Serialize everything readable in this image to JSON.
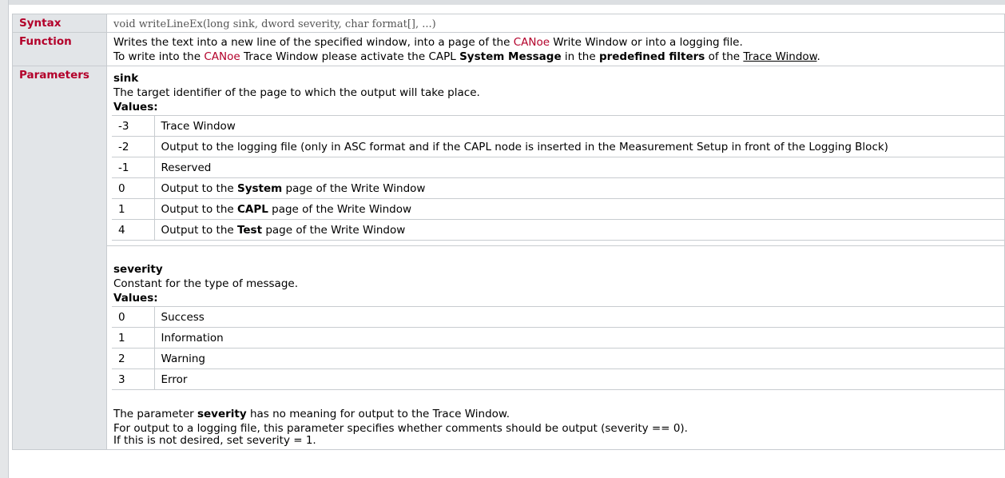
{
  "rows": {
    "syntax": {
      "label": "Syntax",
      "code": "void writeLineEx(long sink, dword severity, char format[], ...)"
    },
    "function": {
      "label": "Function",
      "line1": {
        "a": "Writes the text into a new line of the specified window, into a page of the ",
        "canoe": "CANoe",
        "b": " Write Window or into a logging file."
      },
      "line2": {
        "a": "To write into the ",
        "canoe": "CANoe",
        "b": " Trace Window please activate the CAPL ",
        "bold1": "System Message",
        "c": " in the ",
        "bold2": "predefined filters",
        "d": " of the ",
        "link": "Trace Window",
        "e": "."
      }
    },
    "parameters": {
      "label": "Parameters",
      "sink": {
        "name": "sink",
        "desc": "The target identifier of the page to which the output will take place.",
        "values_label": "Values:",
        "values": [
          {
            "value": "-3",
            "pre": "Trace Window",
            "bold": "",
            "post": ""
          },
          {
            "value": "-2",
            "pre": "Output to the logging file (only in ASC format and if the CAPL node is inserted in the Measurement Setup in front of the Logging Block)",
            "bold": "",
            "post": ""
          },
          {
            "value": "-1",
            "pre": "Reserved",
            "bold": "",
            "post": ""
          },
          {
            "value": "0",
            "pre": "Output to the ",
            "bold": "System",
            "post": " page of the Write Window"
          },
          {
            "value": "1",
            "pre": "Output to the ",
            "bold": "CAPL",
            "post": " page of the Write Window"
          },
          {
            "value": "4",
            "pre": "Output to the ",
            "bold": "Test",
            "post": " page of the Write Window"
          }
        ]
      },
      "severity": {
        "name": "severity",
        "desc": "Constant for the type of message.",
        "values_label": "Values:",
        "values": [
          {
            "value": "0",
            "text": "Success"
          },
          {
            "value": "1",
            "text": "Information"
          },
          {
            "value": "2",
            "text": "Warning"
          },
          {
            "value": "3",
            "text": "Error"
          }
        ],
        "note1": {
          "a": "The parameter ",
          "bold": "severity",
          "b": " has no meaning for output to the Trace Window."
        },
        "note2": "For output to a logging file, this parameter specifies whether comments should be output (severity == 0).",
        "note3": "If this is not desired, set severity = 1."
      }
    }
  },
  "colors": {
    "label_text": "#b3002a",
    "label_bg": "#e2e5e8",
    "border": "#c8ccd0",
    "canoe": "#b3002a"
  }
}
